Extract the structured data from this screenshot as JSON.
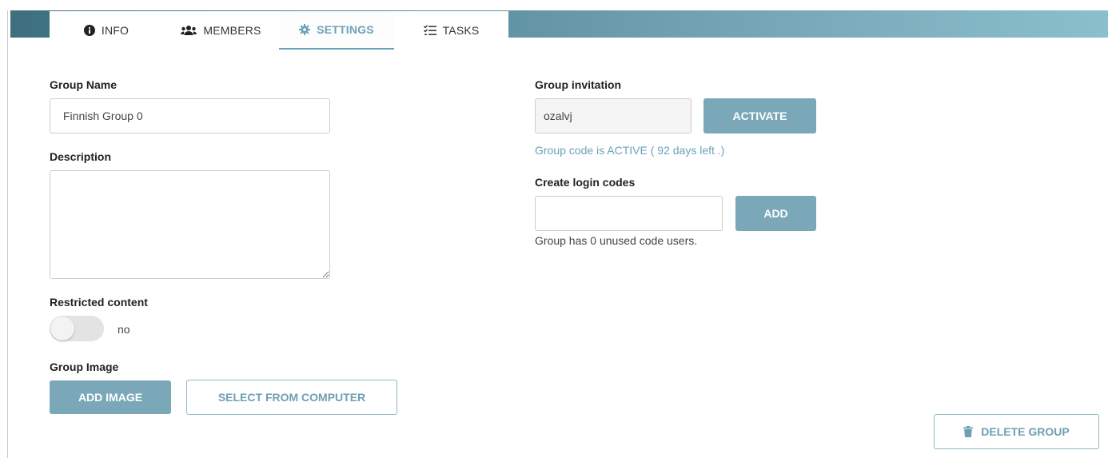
{
  "tabs": [
    {
      "label": "INFO",
      "icon": "info-circle-icon"
    },
    {
      "label": "MEMBERS",
      "icon": "users-icon"
    },
    {
      "label": "SETTINGS",
      "icon": "gear-icon",
      "active": true
    },
    {
      "label": "TASKS",
      "icon": "task-list-icon"
    }
  ],
  "group_name": {
    "label": "Group Name",
    "value": "Finnish Group 0"
  },
  "description": {
    "label": "Description",
    "value": ""
  },
  "restricted": {
    "label": "Restricted content",
    "state_text": "no",
    "enabled": false
  },
  "group_image": {
    "label": "Group Image",
    "add_button": "ADD IMAGE",
    "select_button": "SELECT FROM COMPUTER"
  },
  "invitation": {
    "label": "Group invitation",
    "code": "ozalvj",
    "activate_button": "ACTIVATE",
    "status": "Group code is ACTIVE ( 92 days left .)"
  },
  "login_codes": {
    "label": "Create login codes",
    "value": "",
    "add_button": "ADD",
    "info": "Group has 0 unused code users."
  },
  "delete_button": {
    "label": "DELETE GROUP",
    "icon": "trash-icon"
  },
  "colors": {
    "accent": "#7aa8b8",
    "accent_text": "#6aa3b8",
    "header_dark": "#3d6f7f",
    "header_light": "#8cbfcc"
  }
}
